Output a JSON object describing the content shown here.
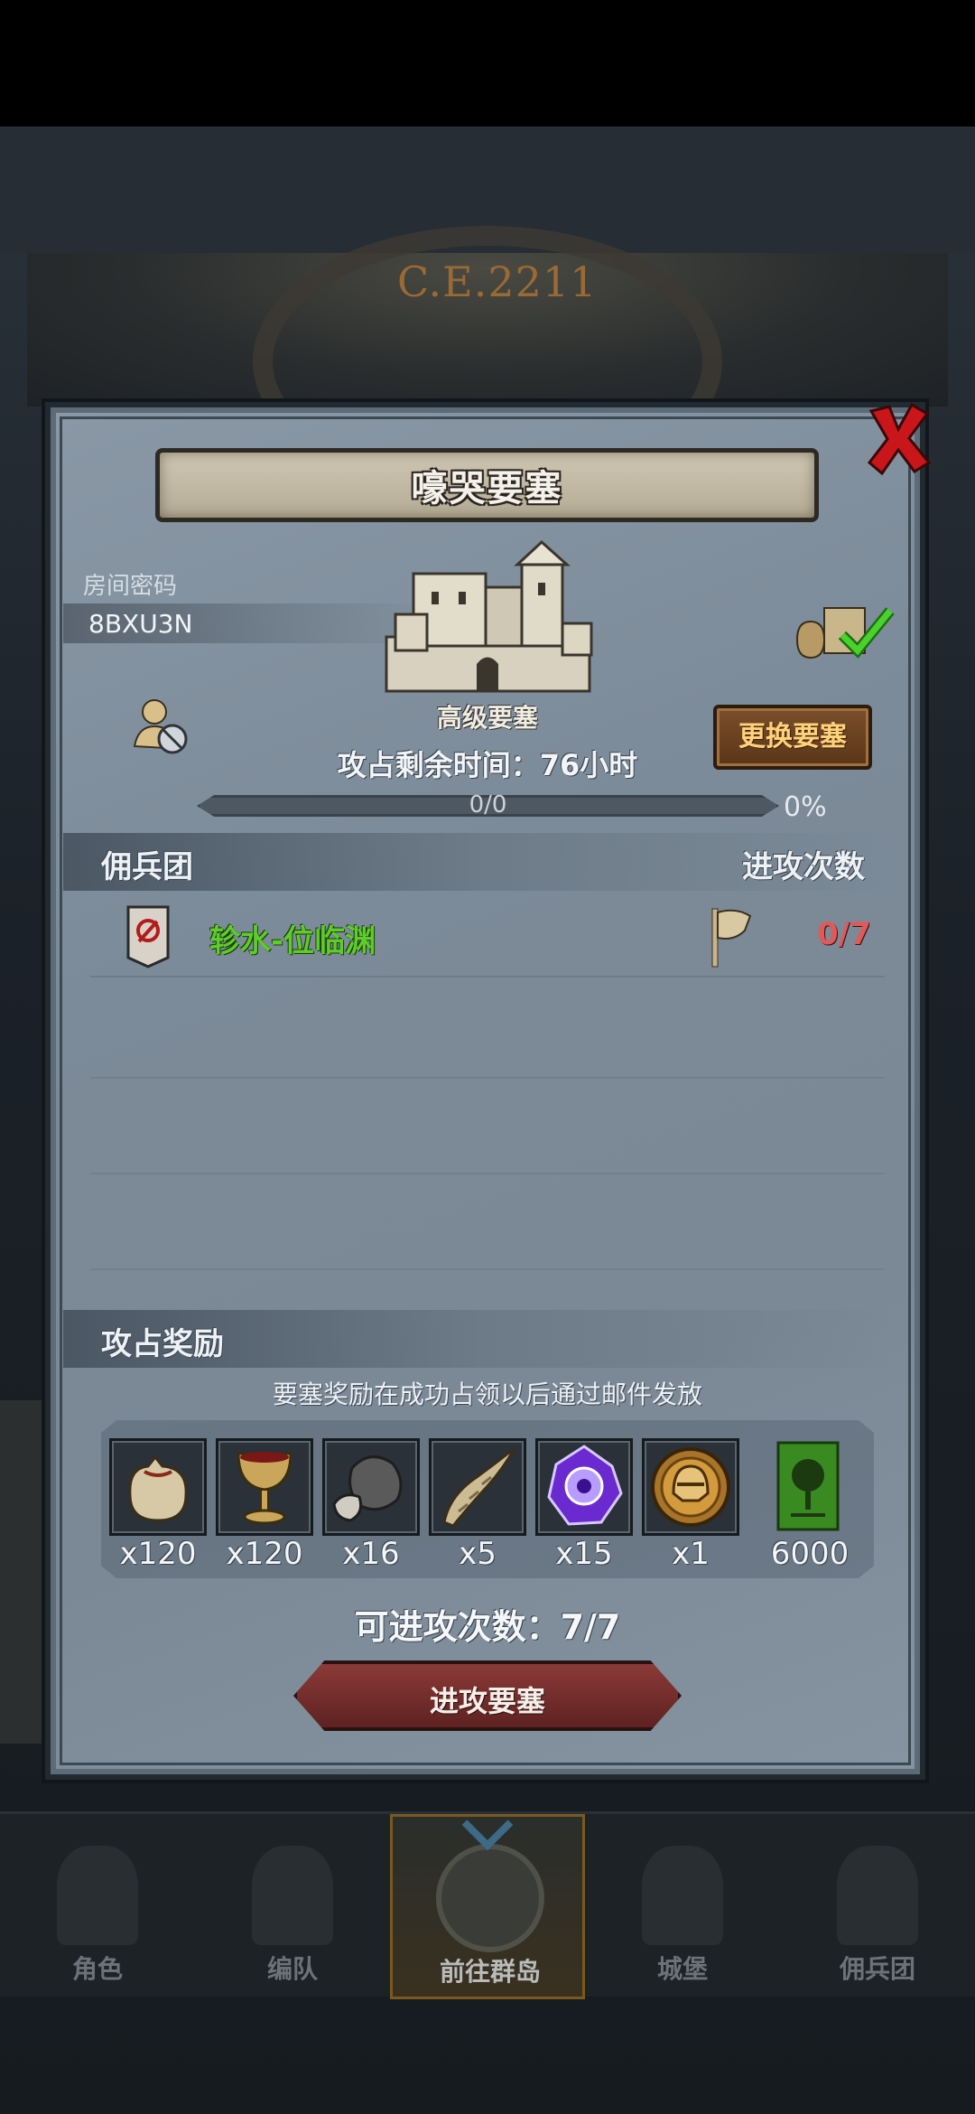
{
  "header": {
    "era": "C.E.2211"
  },
  "dialog": {
    "title": "嚎哭要塞",
    "room": {
      "label": "房间密码",
      "code": "8BXU3N"
    },
    "fortress_grade": "高级要塞",
    "change_button": "更换要塞",
    "time_left": "攻占剩余时间：76小时",
    "progress": {
      "text": "0/0",
      "percent": "0%",
      "fraction": 0
    },
    "legion_section": {
      "title": "佣兵团",
      "attacks_header": "进攻次数"
    },
    "legions": [
      {
        "name": "轸水-位临渊",
        "attacks": "0/7"
      }
    ],
    "rewards_section": {
      "title": "攻占奖励",
      "note": "要塞奖励在成功占领以后通过邮件发放",
      "items": [
        {
          "icon": "sack-icon",
          "qty": "x120"
        },
        {
          "icon": "goblet-icon",
          "qty": "x120"
        },
        {
          "icon": "ore-icon",
          "qty": "x16"
        },
        {
          "icon": "horn-icon",
          "qty": "x5"
        },
        {
          "icon": "crystal-icon",
          "qty": "x15"
        },
        {
          "icon": "helmet-medal-icon",
          "qty": "x1"
        },
        {
          "icon": "tree-banner-icon",
          "qty": "6000"
        }
      ]
    },
    "attacks_available": "可进攻次数：7/7",
    "attack_button": "进攻要塞"
  },
  "bottom_nav": [
    {
      "label": "角色",
      "icon": "knight-icon"
    },
    {
      "label": "编队",
      "icon": "helmet-icon"
    },
    {
      "label": "前往群岛",
      "icon": "compass-map-icon",
      "active": true
    },
    {
      "label": "城堡",
      "icon": "castle-icon"
    },
    {
      "label": "佣兵团",
      "icon": "legion-flag-icon"
    }
  ],
  "colors": {
    "legion_name": "#5dcc2c",
    "attack_count": "#e05a5a",
    "change_button_text": "#ffd27a"
  }
}
